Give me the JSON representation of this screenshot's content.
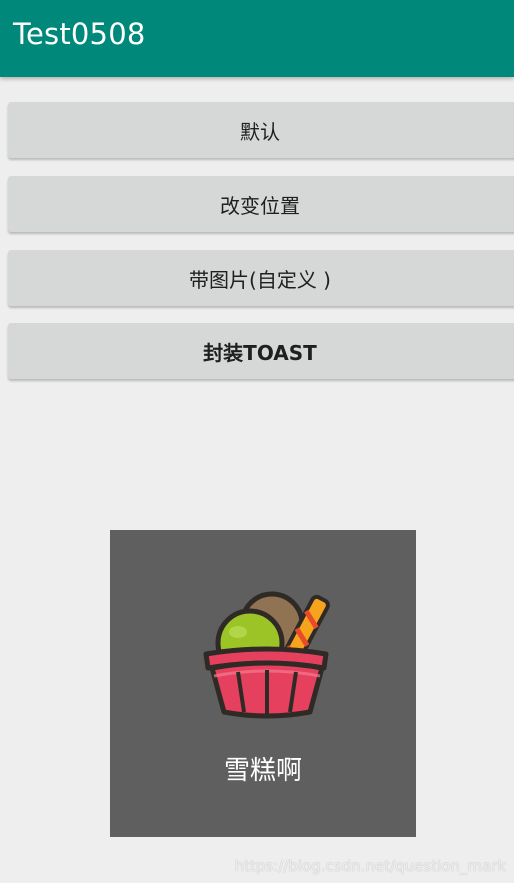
{
  "app_bar": {
    "title": "Test0508",
    "color": "#00897b"
  },
  "buttons": [
    {
      "label": "默认"
    },
    {
      "label": "改变位置"
    },
    {
      "label": "带图片(自定义 )"
    },
    {
      "label": "封装TOAST"
    }
  ],
  "toast": {
    "icon": "ice-cream-cup-icon",
    "text": "雪糕啊",
    "background": "#5f5f5f"
  },
  "watermark": "https://blog.csdn.net/question_mark"
}
